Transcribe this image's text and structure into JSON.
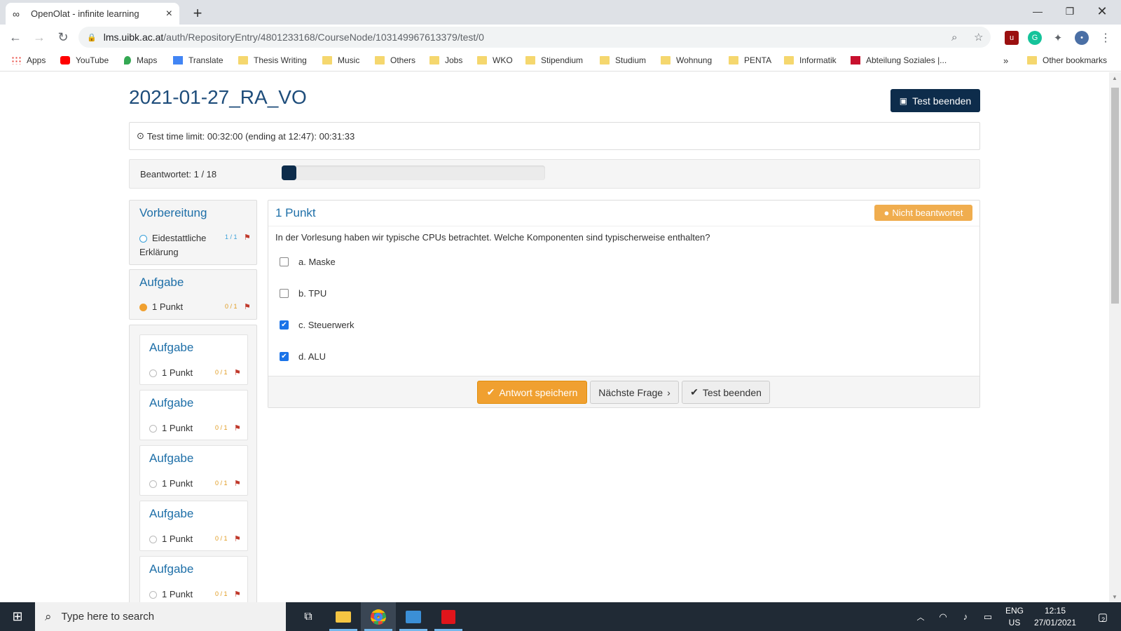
{
  "browser": {
    "tab_title": "OpenOlat - infinite learning",
    "url_host": "lms.uibk.ac.at",
    "url_path": "/auth/RepositoryEntry/4801233168/CourseNode/103149967613379/test/0",
    "bookmarks": [
      "Apps",
      "YouTube",
      "Maps",
      "Translate",
      "Thesis Writing",
      "Music",
      "Others",
      "Jobs",
      "WKO",
      "Stipendium",
      "Studium",
      "Wohnung",
      "PENTA",
      "Informatik",
      "Abteilung Soziales |..."
    ],
    "more_bookmarks": "»",
    "other_bookmarks": "Other bookmarks"
  },
  "page": {
    "title": "2021-01-27_RA_VO",
    "end_test_button": "Test beenden",
    "timer_text": "Test time limit: 00:32:00 (ending at 12:47): 00:31:33",
    "progress_label": "Beantwortet: 1 / 18",
    "progress_fraction": 0.0556
  },
  "sidebar": {
    "section1": {
      "heading": "Vorbereitung",
      "item_line1": "Eidestattliche",
      "item_line2": "Erklärung",
      "score": "1 / 1"
    },
    "section2": {
      "heading": "Aufgabe",
      "item": "1 Punkt",
      "score": "0 / 1"
    },
    "tasks": [
      {
        "heading": "Aufgabe",
        "item": "1 Punkt",
        "score": "0 / 1"
      },
      {
        "heading": "Aufgabe",
        "item": "1 Punkt",
        "score": "0 / 1"
      },
      {
        "heading": "Aufgabe",
        "item": "1 Punkt",
        "score": "0 / 1"
      },
      {
        "heading": "Aufgabe",
        "item": "1 Punkt",
        "score": "0 / 1"
      },
      {
        "heading": "Aufgabe",
        "item": "1 Punkt",
        "score": "0 / 1"
      }
    ]
  },
  "question": {
    "title": "1 Punkt",
    "status_badge": "Nicht beantwortet",
    "text": "In der Vorlesung haben wir typische CPUs betrachtet. Welche Komponenten sind typischerweise enthalten?",
    "options": [
      {
        "label": "a. Maske",
        "checked": false
      },
      {
        "label": "b. TPU",
        "checked": false
      },
      {
        "label": "c. Steuerwerk",
        "checked": true
      },
      {
        "label": "d. ALU",
        "checked": true
      }
    ],
    "save_button": "Antwort speichern",
    "next_button": "Nächste Frage",
    "end_button": "Test beenden"
  },
  "taskbar": {
    "search_placeholder": "Type here to search",
    "lang_line1": "ENG",
    "lang_line2": "US",
    "time": "12:15",
    "date": "27/01/2021",
    "notification_count": "2"
  }
}
